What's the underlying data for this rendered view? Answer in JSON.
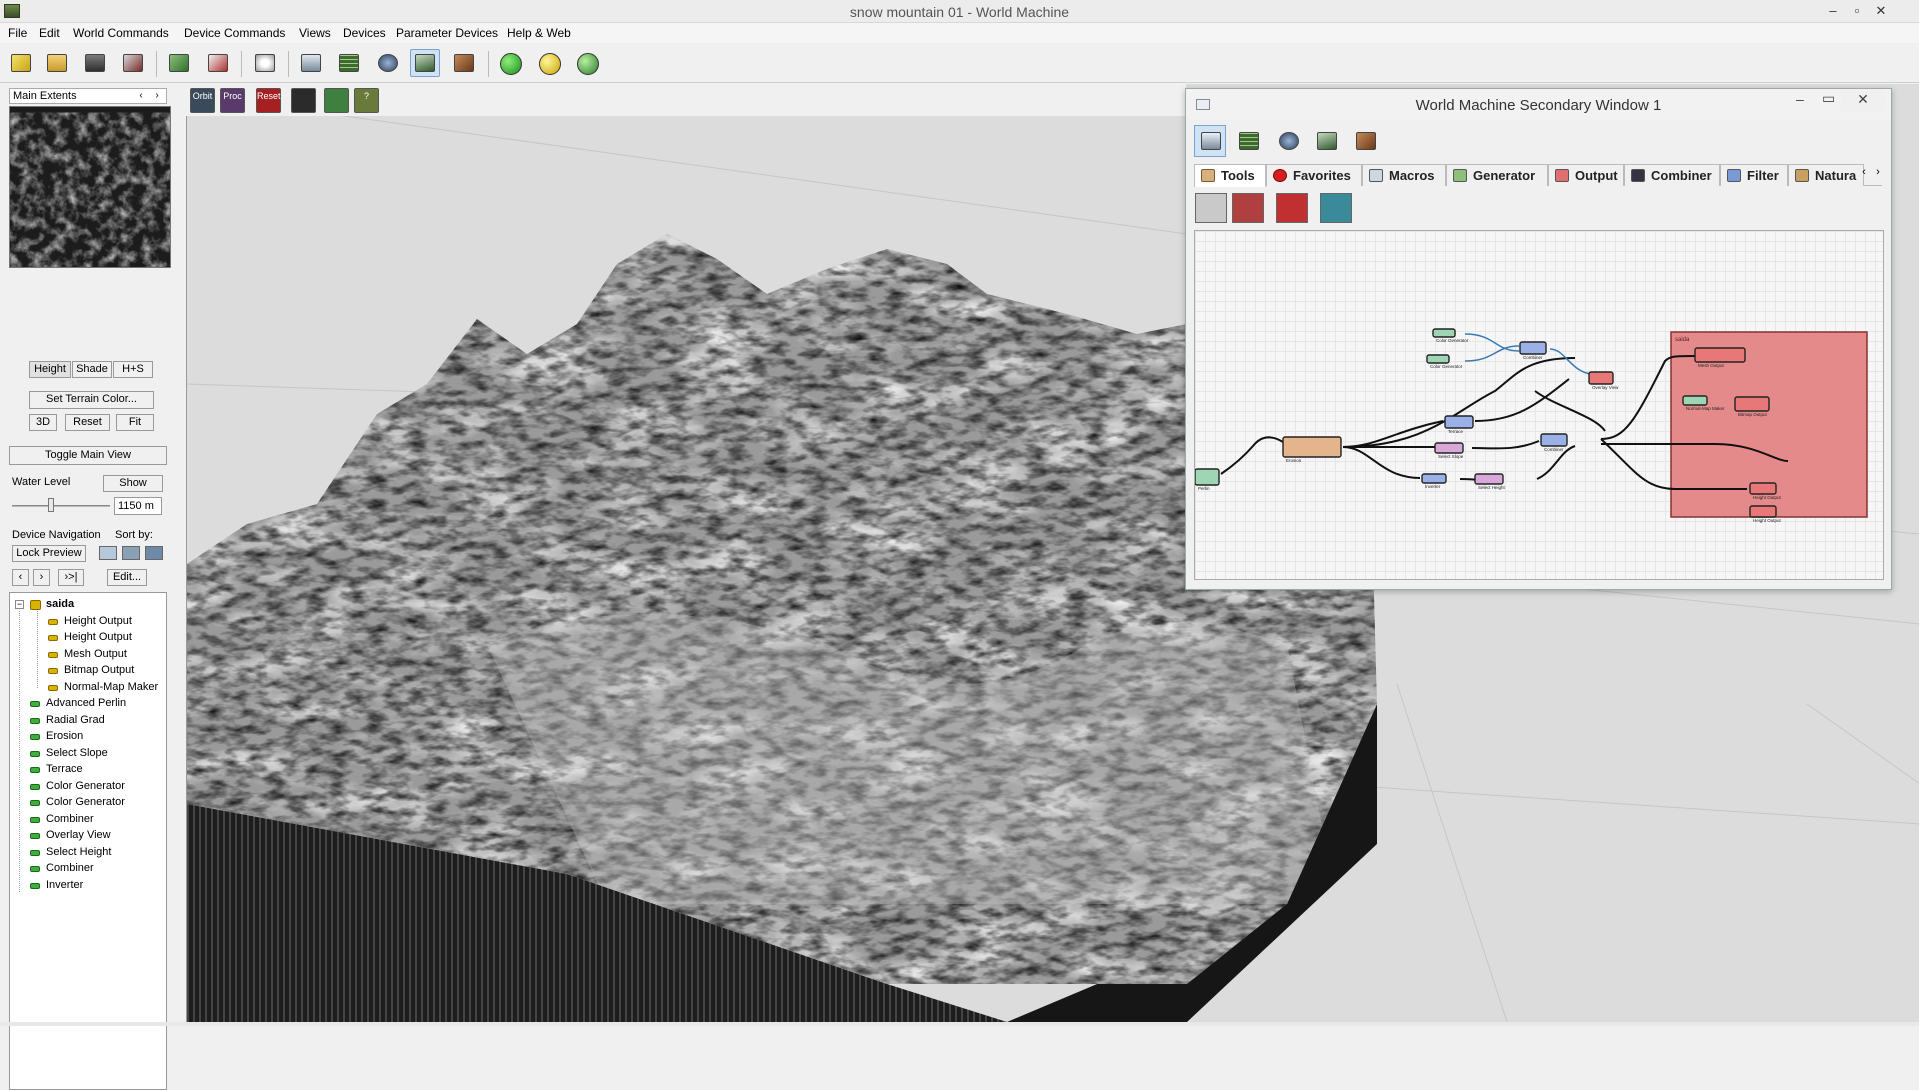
{
  "window": {
    "title": "snow mountain 01 - World Machine",
    "controls": {
      "minimize": "–",
      "restore": "▫",
      "close": "✕"
    }
  },
  "menu": [
    "File",
    "Edit",
    "World Commands",
    "Device Commands",
    "Views",
    "Devices",
    "Parameter Devices",
    "Help & Web"
  ],
  "toolbar": {
    "icons": [
      "new-world-icon",
      "open-icon",
      "save-icon",
      "wizard-icon",
      "build-icon",
      "export-icon",
      "random-seed-icon",
      "view-layout-icon",
      "world-grid-icon",
      "globe-icon",
      "terrain-3d-icon",
      "texture-icon",
      "green-ball-icon",
      "yellow-ball-icon",
      "multi-ball-icon"
    ],
    "active": "terrain-3d-icon"
  },
  "left_panel": {
    "extents_label": "Main Extents",
    "extents_prev": "‹",
    "extents_next": "›",
    "view_modes": [
      "Height",
      "Shade",
      "H+S"
    ],
    "set_terrain_color": "Set Terrain Color...",
    "btn_3d": "3D",
    "btn_reset": "Reset",
    "btn_fit": "Fit",
    "toggle_main_view": "Toggle Main View",
    "water_level_label": "Water Level",
    "water_show": "Show",
    "water_value": "1150 m",
    "water_level_fraction": 0.4,
    "device_navigation_label": "Device Navigation",
    "sort_by_label": "Sort by:",
    "lock_preview": "Lock Preview",
    "nav_prev": "‹",
    "nav_next": "›",
    "nav_last": "›>|",
    "edit": "Edit...",
    "tree": {
      "root": "saida",
      "children": [
        "Height Output",
        "Height Output",
        "Mesh Output",
        "Bitmap Output",
        "Normal-Map Maker"
      ],
      "devices": [
        "Advanced Perlin",
        "Radial Grad",
        "Erosion",
        "Select Slope",
        "Terrace",
        "Color Generator",
        "Color Generator",
        "Combiner",
        "Overlay View",
        "Select Height",
        "Combiner",
        "Inverter"
      ]
    }
  },
  "view_toolbar": {
    "buttons": [
      {
        "label": "Orbit",
        "color": "#3a4a5a"
      },
      {
        "label": "Proc",
        "color": "#5a3a6a"
      },
      {
        "label": "Reset",
        "color": "#a52020"
      },
      {
        "label": "",
        "color": "#2b2b2b"
      },
      {
        "label": "",
        "color": "#3f7f3f"
      },
      {
        "label": "?",
        "color": "#6a7a3a"
      }
    ]
  },
  "secondary_window": {
    "title": "World Machine Secondary Window 1",
    "close": "✕",
    "tabs": [
      "Tools",
      "Favorites",
      "Macros",
      "Generator",
      "Output",
      "Combiner",
      "Filter",
      "Natura"
    ],
    "tab_prev": "‹",
    "tab_next": "›",
    "selected_tab": "Tools",
    "group_label": "saida",
    "nodes": [
      {
        "label": "Color Generator",
        "color": "#9ed6b4"
      },
      {
        "label": "Color Generator",
        "color": "#9ed6b4"
      },
      {
        "label": "Combiner",
        "color": "#9ab0e6"
      },
      {
        "label": "Overlay View",
        "color": "#e87878"
      },
      {
        "label": "Terrace",
        "color": "#9ab0e6"
      },
      {
        "label": "Select Slope",
        "color": "#d8a8d8"
      },
      {
        "label": "Erosion",
        "color": "#e4b48c"
      },
      {
        "label": "Perlin",
        "color": "#9ed6b4"
      },
      {
        "label": "Inverter",
        "color": "#9ab0e6"
      },
      {
        "label": "Select Height",
        "color": "#d8a8d8"
      },
      {
        "label": "Combiner",
        "color": "#9ab0e6"
      },
      {
        "label": "Mesh Output",
        "color": "#e87878"
      },
      {
        "label": "Normal-Map Maker",
        "color": "#9ed6b4"
      },
      {
        "label": "Bitmap Output",
        "color": "#e87878"
      },
      {
        "label": "Height Output",
        "color": "#e87878"
      },
      {
        "label": "Height Output",
        "color": "#e87878"
      }
    ]
  }
}
